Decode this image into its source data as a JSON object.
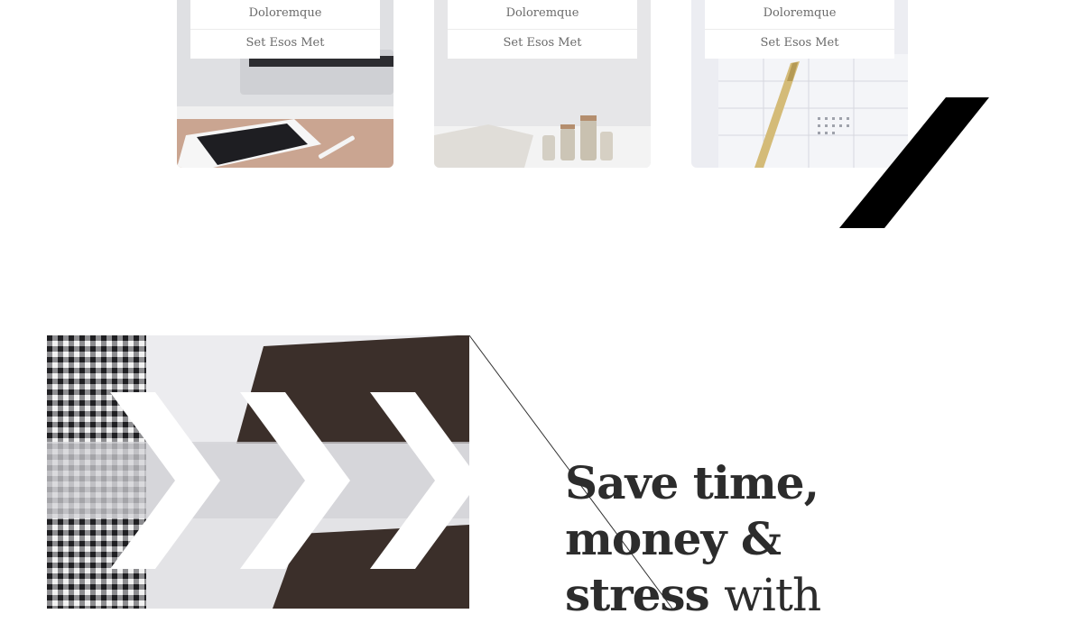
{
  "cards": [
    {
      "title": "Doloremque",
      "subtitle": "Set Esos Met"
    },
    {
      "title": "Doloremque",
      "subtitle": "Set Esos Met"
    },
    {
      "title": "Doloremque",
      "subtitle": "Set Esos Met"
    }
  ],
  "hero": {
    "line1": "Save time,",
    "line2": "money &",
    "line3_bold": "stress",
    "line3_light": "with"
  },
  "colors": {
    "text": "#2c2c2c",
    "muted": "#6a6a6a",
    "accent": "#000000"
  },
  "icons": [
    "decorative-slash-shape",
    "chevron-arrow-pattern"
  ]
}
